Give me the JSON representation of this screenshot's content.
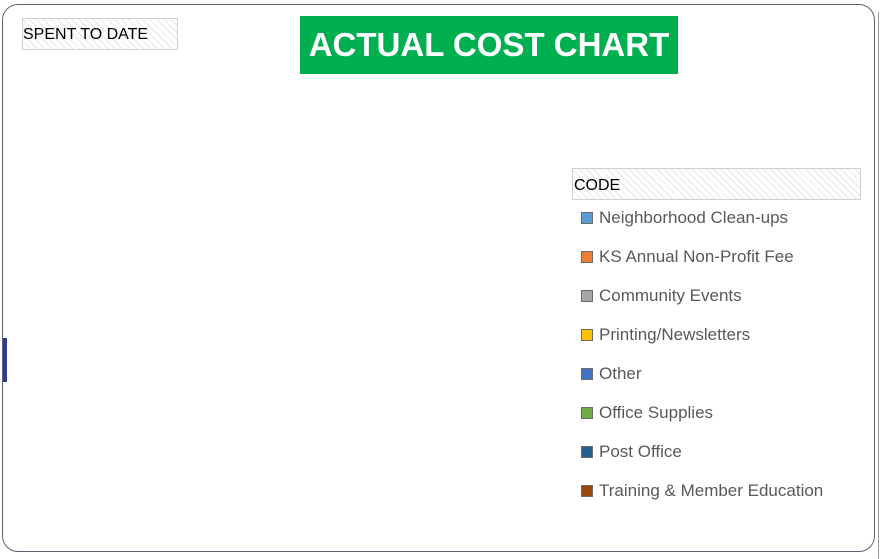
{
  "chart_data": {
    "type": "pie",
    "title": "ACTUAL COST CHART",
    "subtitle": "SPENT TO DATE",
    "legend_title": "CODE",
    "legend_position": "right",
    "categories": [
      "Neighborhood Clean-ups",
      "KS Annual Non-Profit Fee",
      "Community Events",
      "Printing/Newsletters",
      "Other",
      "Office Supplies",
      "Post Office",
      "Training & Member Education"
    ],
    "colors": [
      "#5b9bd5",
      "#ed7d31",
      "#a5a5a5",
      "#ffc000",
      "#4472c4",
      "#70ad47",
      "#255e91",
      "#9e480e"
    ],
    "values": []
  },
  "title_bg_color": "#00b050"
}
